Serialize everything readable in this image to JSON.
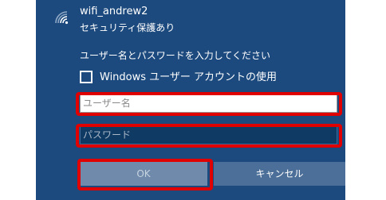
{
  "network": {
    "ssid": "wifi_andrew2",
    "security": "セキュリティ保護あり"
  },
  "prompt": "ユーザー名とパスワードを入力してください",
  "use_account_checkbox": {
    "label": "Windows ユーザー アカウントの使用",
    "checked": false
  },
  "username_field": {
    "placeholder": "ユーザー名",
    "value": ""
  },
  "password_field": {
    "placeholder": "パスワード",
    "value": ""
  },
  "buttons": {
    "ok_label": "OK",
    "cancel_label": "キャンセル"
  },
  "colors": {
    "panel_bg": "#1c4a7e",
    "highlight": "#e00000"
  }
}
